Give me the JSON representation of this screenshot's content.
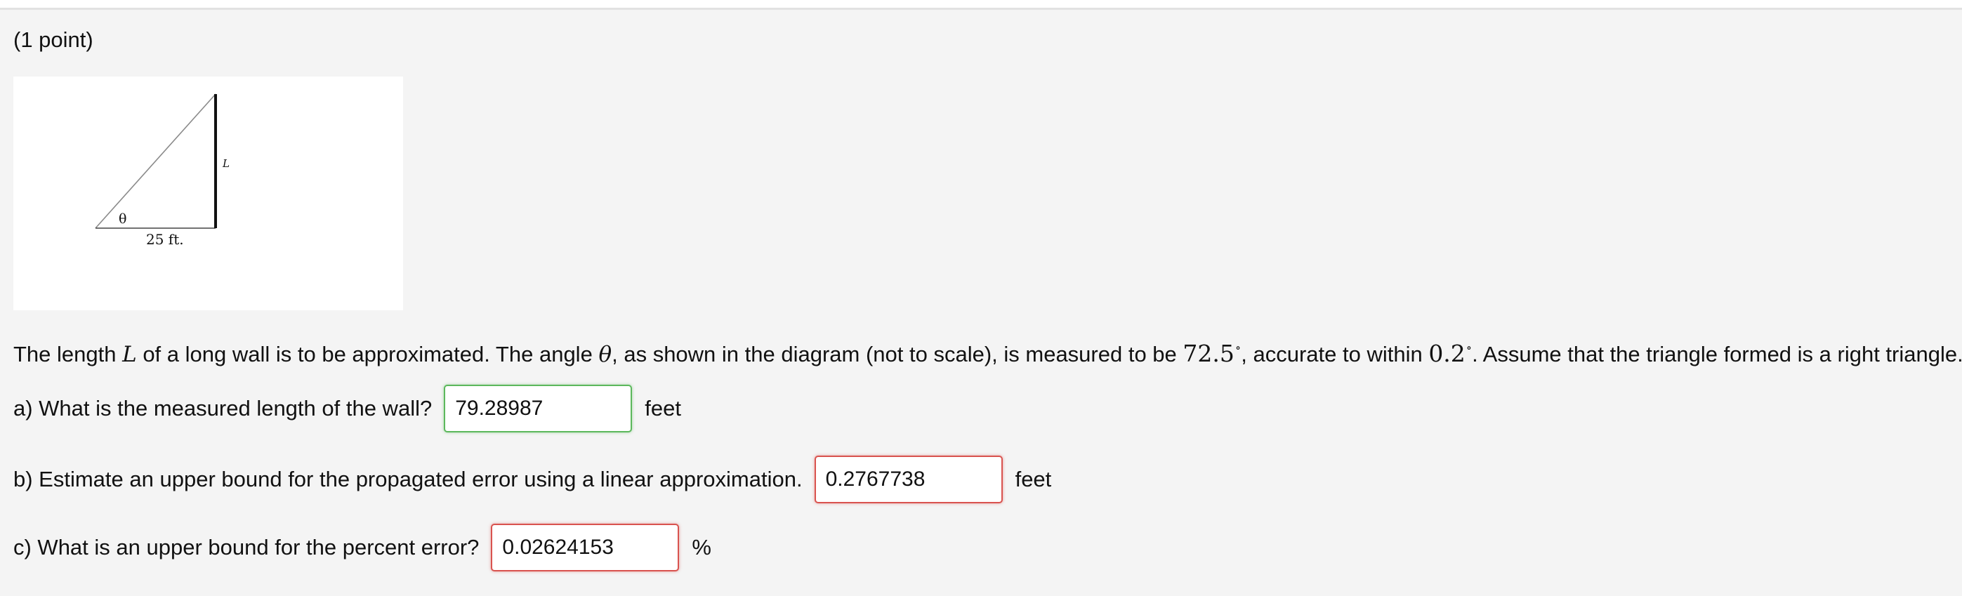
{
  "header": {
    "points": "(1 point)"
  },
  "diagram": {
    "angle_label": "θ",
    "side_label": "L",
    "base_label": "25 ft."
  },
  "problem": {
    "text_1": "The length ",
    "var_L": "L",
    "text_2": " of a long wall is to be approximated. The angle ",
    "var_theta": "θ",
    "text_3": ", as shown in the diagram (not to scale), is measured to be ",
    "angle_value": "72.5",
    "degree_symbol": "∘",
    "text_4": ", accurate to within ",
    "accuracy_value": "0.2",
    "text_5": ". Assume that the triangle formed is a right triangle."
  },
  "questions": [
    {
      "prompt": "a) What is the measured length of the wall?",
      "value": "79.28987",
      "status": "correct",
      "unit": "feet"
    },
    {
      "prompt": "b) Estimate an upper bound for the propagated error using a linear approximation.",
      "value": "0.2767738",
      "status": "incorrect",
      "unit": "feet"
    },
    {
      "prompt": "c) What is an upper bound for the percent error?",
      "value": "0.02624153",
      "status": "incorrect",
      "unit": "%"
    }
  ],
  "colors": {
    "correct_border": "#5cb85c",
    "incorrect_border": "#d9534f",
    "page_background": "#f4f4f4"
  }
}
